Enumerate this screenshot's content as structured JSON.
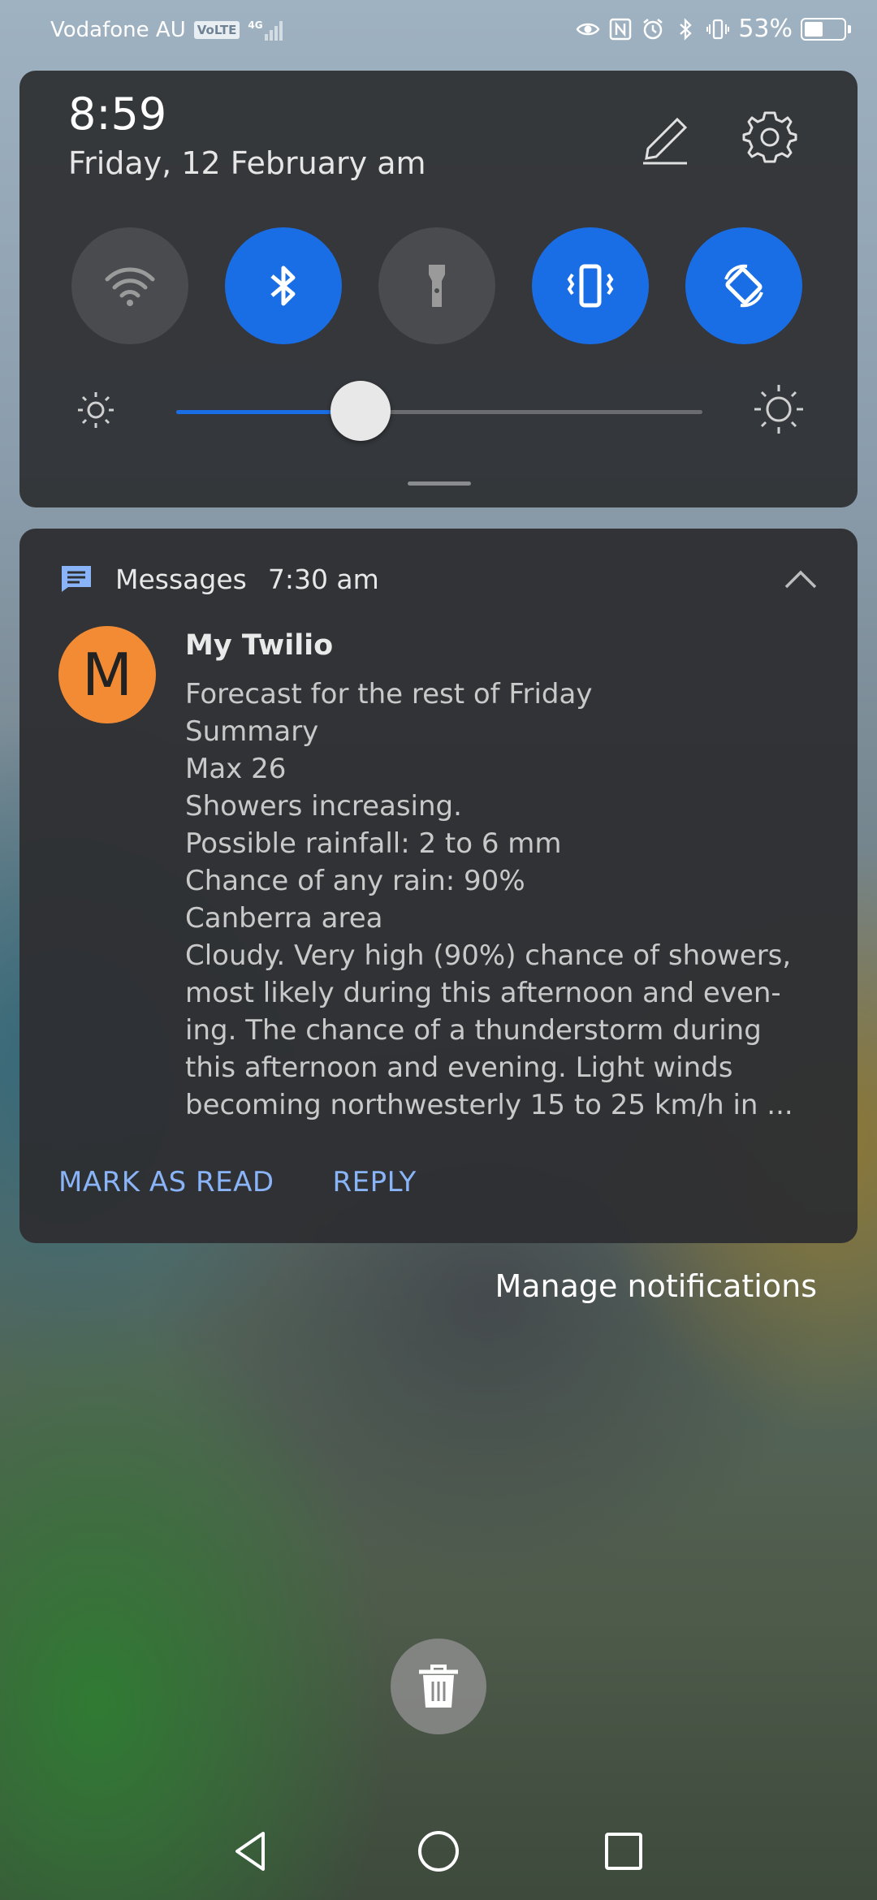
{
  "status_bar": {
    "carrier": "Vodafone AU",
    "volte": "VoLTE",
    "network": "4G",
    "battery_percent": "53%",
    "battery_level": 0.53,
    "icons": [
      "eye-icon",
      "nfc-icon",
      "alarm-icon",
      "bluetooth-icon",
      "vibrate-icon",
      "battery-icon"
    ]
  },
  "quick_settings": {
    "time": "8:59",
    "date": "Friday, 12 February  am",
    "tiles": [
      {
        "name": "wifi",
        "icon": "wifi-icon",
        "active": false
      },
      {
        "name": "bluetooth",
        "icon": "bluetooth-icon",
        "active": true
      },
      {
        "name": "flashlight",
        "icon": "flashlight-icon",
        "active": false
      },
      {
        "name": "vibrate",
        "icon": "vibrate-icon",
        "active": true
      },
      {
        "name": "auto-rotate",
        "icon": "rotate-icon",
        "active": true
      }
    ],
    "brightness_level": 0.35,
    "colors": {
      "active": "#1a6ee5",
      "inactive": "#4a4b4e"
    }
  },
  "notification": {
    "app_name": "Messages",
    "time": "7:30 am",
    "avatar_letter": "M",
    "avatar_color": "#f28b33",
    "sender": "My Twilio",
    "body_lines": [
      "Forecast for the rest of Friday",
      "Summary",
      "Max 26",
      "Showers increasing.",
      "Possible rainfall: 2 to 6 mm",
      "Chance of any rain: 90%",
      "Canberra area",
      "Cloudy. Very high (90%) chance of showers,",
      "most likely during this afternoon and even-",
      "ing. The chance of a thunderstorm during",
      "this afternoon and evening. Light winds",
      "becoming northwesterly 15 to 25 km/h in ..."
    ],
    "actions": {
      "mark_as_read": "MARK AS READ",
      "reply": "REPLY"
    },
    "action_color": "#8ab4f8"
  },
  "manage_notifications": "Manage notifications",
  "navigation": {
    "buttons": [
      "back-icon",
      "home-icon",
      "recents-icon"
    ]
  }
}
